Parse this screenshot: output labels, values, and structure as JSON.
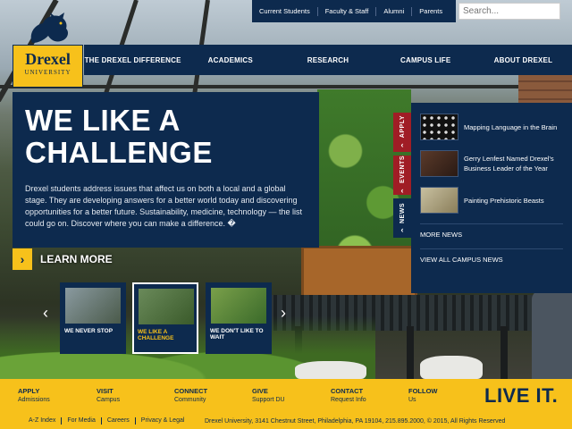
{
  "utility_nav": [
    "Current Students",
    "Faculty & Staff",
    "Alumni",
    "Parents"
  ],
  "search": {
    "placeholder": "Search..."
  },
  "logo": {
    "name": "Drexel",
    "subtitle": "UNIVERSITY"
  },
  "main_nav": [
    "THE DREXEL DIFFERENCE",
    "ACADEMICS",
    "RESEARCH",
    "CAMPUS LIFE",
    "ABOUT DREXEL"
  ],
  "hero": {
    "title": "WE LIKE A CHALLENGE",
    "body": "Drexel students address issues that affect us on both a local and a global stage. They are developing answers for a better world today and discovering opportunities for a better future. Sustainability, medicine, technology — the list could go on. Discover where you can make a difference. �",
    "cta": "LEARN MORE",
    "cta_arrow": "›"
  },
  "side_tabs": [
    {
      "label": "APPLY",
      "color": "#a01d25"
    },
    {
      "label": "EVENTS",
      "color": "#a01d25"
    },
    {
      "label": "NEWS",
      "color": "#0d2a4e"
    }
  ],
  "news": {
    "items": [
      "Mapping Language in the Brain",
      "Gerry Lenfest Named Drexel's Business Leader of the Year",
      "Painting Prehistoric Beasts"
    ],
    "more_news": "MORE NEWS",
    "view_all": "VIEW ALL CAMPUS NEWS"
  },
  "carousel": [
    "WE NEVER STOP",
    "WE LIKE A CHALLENGE",
    "WE DON'T LIKE TO WAIT"
  ],
  "carousel_prev": "‹",
  "carousel_next": "›",
  "footer": {
    "columns": [
      {
        "heading": "APPLY",
        "sub": "Admissions"
      },
      {
        "heading": "VISIT",
        "sub": "Campus"
      },
      {
        "heading": "CONNECT",
        "sub": "Community"
      },
      {
        "heading": "GIVE",
        "sub": "Support DU"
      },
      {
        "heading": "CONTACT",
        "sub": "Request Info"
      },
      {
        "heading": "FOLLOW",
        "sub": "Us"
      }
    ],
    "tagline": "LIVE IT.",
    "links": [
      "A-Z Index",
      "For Media",
      "Careers",
      "Privacy & Legal"
    ],
    "address": "Drexel University, 3141 Chestnut Street, Philadelphia, PA 19104, 215.895.2000, © 2015, All Rights Reserved"
  },
  "colors": {
    "navy": "#0d2a4e",
    "gold": "#f7c11b",
    "red": "#a01d25"
  }
}
